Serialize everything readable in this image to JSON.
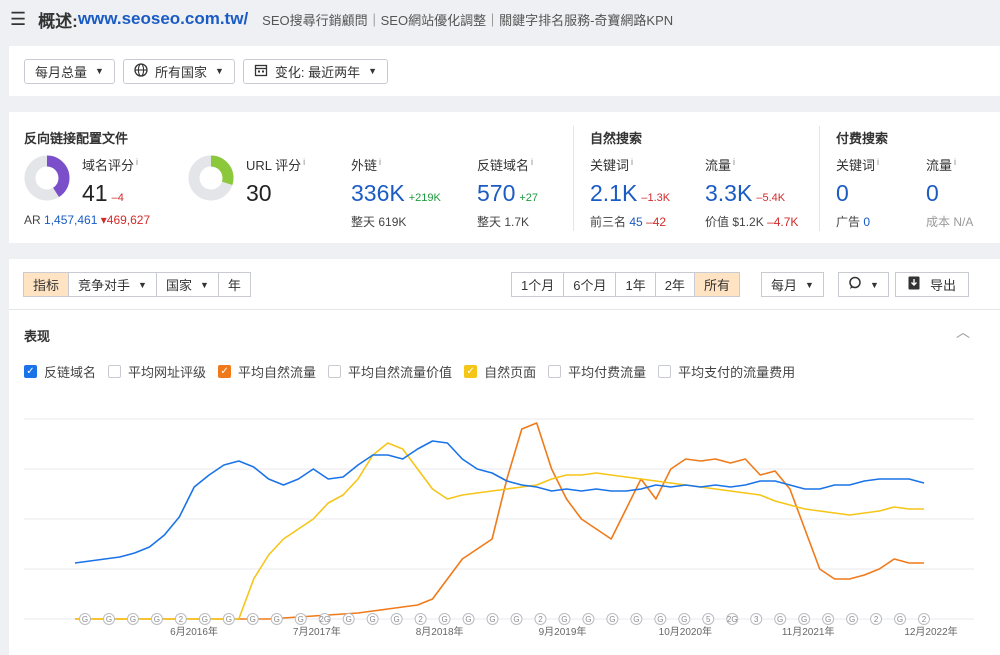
{
  "topbar": {
    "menu_icon": "hamburger-icon",
    "title_prefix": "概述:",
    "title_url": "www.seoseo.com.tw/",
    "subtitle": "SEO搜尋行銷顧問｜SEO網站優化調整｜關鍵字排名服務-奇寶網路KPN"
  },
  "filters": {
    "volume": "每月总量",
    "country": "所有国家",
    "change": "变化: 最近两年"
  },
  "backlinks": {
    "title": "反向链接配置文件",
    "domain_rating": {
      "label": "域名评分",
      "value": "41",
      "delta": "–4",
      "fill": 41,
      "color": "#7b4fc9"
    },
    "url_rating": {
      "label": "URL 评分",
      "value": "30",
      "fill": 30,
      "color": "#8cc83c"
    },
    "ar_label": "AR",
    "ar_value": "1,457,461",
    "ar_delta": "▾469,627",
    "outlinks": {
      "label": "外链",
      "value": "336K",
      "delta": "+219K",
      "sub_label": "整天",
      "sub_value": "619K"
    },
    "ref_domains": {
      "label": "反链域名",
      "value": "570",
      "delta": "+27",
      "sub_label": "整天",
      "sub_value": "1.7K"
    }
  },
  "organic": {
    "title": "自然搜索",
    "keywords": {
      "label": "关键词",
      "value": "2.1K",
      "delta": "–1.3K",
      "sub_label": "前三名",
      "sub_value": "45",
      "sub_delta": "–42"
    },
    "traffic": {
      "label": "流量",
      "value": "3.3K",
      "delta": "–5.4K",
      "sub_label": "价值",
      "sub_value": "$1.2K",
      "sub_delta": "–4.7K"
    }
  },
  "paid": {
    "title": "付费搜索",
    "keywords": {
      "label": "关键词",
      "value": "0",
      "sub_label": "广告",
      "sub_value": "0"
    },
    "traffic": {
      "label": "流量",
      "value": "0",
      "sub_label": "成本",
      "sub_value": "N/A"
    }
  },
  "tabs": {
    "left": [
      "指标",
      "竞争对手",
      "国家",
      "年"
    ],
    "ranges": [
      "1个月",
      "6个月",
      "1年",
      "2年",
      "所有"
    ],
    "interval": "每月",
    "export": "导出"
  },
  "panel": {
    "title": "表现",
    "legend": [
      {
        "label": "反链域名",
        "checked": true,
        "color": "#1a73e8"
      },
      {
        "label": "平均网址评级",
        "checked": false,
        "color": "#c8ccd2"
      },
      {
        "label": "平均自然流量",
        "checked": true,
        "color": "#f07a1a"
      },
      {
        "label": "平均自然流量价值",
        "checked": false,
        "color": "#c8ccd2"
      },
      {
        "label": "自然页面",
        "checked": true,
        "color": "#f5c518"
      },
      {
        "label": "平均付费流量",
        "checked": false,
        "color": "#c8ccd2"
      },
      {
        "label": "平均支付的流量费用",
        "checked": false,
        "color": "#c8ccd2"
      }
    ]
  },
  "chart_data": {
    "type": "line",
    "x_tick_labels": [
      "6月2016年",
      "7月2017年",
      "8月2018年",
      "9月2019年",
      "10月2020年",
      "11月2021年",
      "12月2022年"
    ],
    "series": [
      {
        "name": "反链域名",
        "color": "#1a73e8",
        "values": [
          28,
          29,
          30,
          31,
          33,
          36,
          42,
          51,
          66,
          72,
          77,
          79,
          76,
          70,
          67,
          70,
          75,
          70,
          71,
          77,
          82,
          82,
          80,
          85,
          89,
          88,
          80,
          75,
          73,
          69,
          67,
          66,
          64,
          65,
          64,
          65,
          64,
          64,
          65,
          67,
          66,
          67,
          66,
          67,
          66,
          67,
          69,
          69,
          67,
          65,
          65,
          67,
          67,
          69,
          70,
          70,
          70,
          68
        ]
      },
      {
        "name": "平均自然流量",
        "color": "#f07a1a",
        "values": [
          0,
          0,
          0,
          0,
          0,
          0,
          0,
          0,
          0,
          0,
          0,
          0,
          0,
          0,
          0.5,
          1,
          1.5,
          2,
          2.5,
          3,
          4,
          5,
          6,
          7,
          10,
          20,
          30,
          35,
          40,
          70,
          95,
          98,
          75,
          60,
          50,
          45,
          40,
          55,
          70,
          60,
          75,
          80,
          79,
          80,
          78,
          80,
          72,
          74,
          65,
          45,
          25,
          20,
          20,
          22,
          25,
          30,
          28,
          28
        ]
      },
      {
        "name": "自然页面",
        "color": "#f5c518",
        "values": [
          0,
          0,
          0,
          0,
          0,
          0,
          0,
          0,
          0,
          0,
          0,
          0,
          20,
          32,
          40,
          45,
          50,
          58,
          62,
          70,
          82,
          88,
          85,
          75,
          65,
          60,
          62,
          63,
          64,
          65,
          66,
          67,
          70,
          72,
          72,
          73,
          72,
          71,
          70,
          69,
          68,
          67,
          66,
          65,
          64,
          63,
          62,
          59,
          57,
          55,
          54,
          53,
          52,
          53,
          54,
          56,
          55,
          55
        ]
      }
    ],
    "annotation_markers": [
      "G",
      "G",
      "G",
      "G",
      "2",
      "G",
      "G",
      "G",
      "G",
      "G",
      "2G",
      "G",
      "G",
      "G",
      "2",
      "G",
      "G",
      "G",
      "G",
      "2",
      "G",
      "G",
      "G",
      "G",
      "G",
      "G",
      "5",
      "2G",
      "3",
      "G",
      "G",
      "G",
      "G",
      "2",
      "G",
      "2"
    ],
    "ylim": [
      0,
      100
    ],
    "grid": true,
    "legend_position": "top"
  }
}
